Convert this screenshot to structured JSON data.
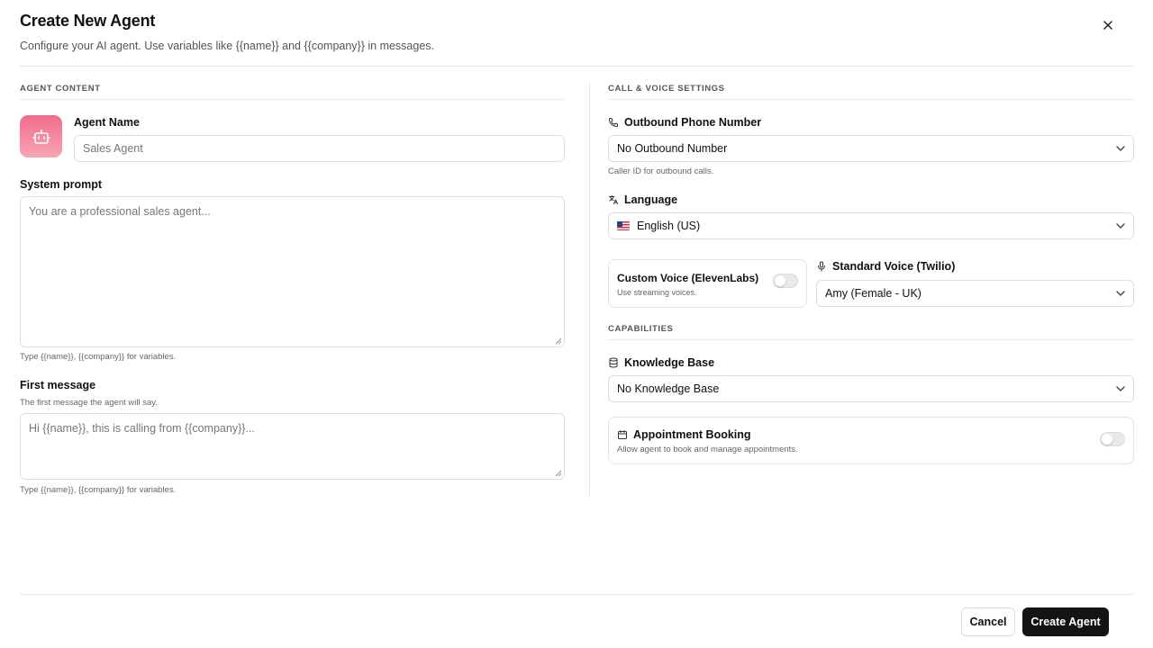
{
  "header": {
    "title": "Create New Agent",
    "subtitle": "Configure your AI agent. Use variables like {{name}} and {{company}} in messages."
  },
  "agent_content": {
    "section_title": "AGENT CONTENT",
    "agent_name": {
      "label": "Agent Name",
      "placeholder": "Sales Agent",
      "value": ""
    },
    "system_prompt": {
      "label": "System prompt",
      "placeholder": "You are a professional sales agent...",
      "hint": "Type {{name}}, {{company}} for variables."
    },
    "first_message": {
      "label": "First message",
      "description": "The first message the agent will say.",
      "placeholder": "Hi {{name}}, this is calling from {{company}}...",
      "hint": "Type {{name}}, {{company}} for variables."
    }
  },
  "call_voice": {
    "section_title": "CALL & VOICE SETTINGS",
    "outbound": {
      "label": "Outbound Phone Number",
      "value": "No Outbound Number",
      "hint": "Caller ID for outbound calls."
    },
    "language": {
      "label": "Language",
      "value": "English (US)"
    },
    "custom_voice": {
      "title": "Custom Voice (ElevenLabs)",
      "subtitle": "Use streaming voices.",
      "enabled": false
    },
    "standard_voice": {
      "label": "Standard Voice (Twilio)",
      "value": "Amy (Female - UK)"
    }
  },
  "capabilities": {
    "section_title": "CAPABILITIES",
    "knowledge_base": {
      "label": "Knowledge Base",
      "value": "No Knowledge Base"
    },
    "appointment": {
      "title": "Appointment Booking",
      "subtitle": "Allow agent to book and manage appointments.",
      "enabled": false
    }
  },
  "footer": {
    "cancel_label": "Cancel",
    "create_label": "Create Agent"
  },
  "icons": {
    "close": "close-icon",
    "avatar": "robot-icon",
    "phone": "phone-icon",
    "language": "translate-icon",
    "mic": "mic-icon",
    "database": "database-icon",
    "calendar": "calendar-icon",
    "chevron": "chevron-down-icon"
  },
  "colors": {
    "primary": "#141414",
    "avatar_top": "#f26b8c",
    "avatar_bottom": "#f7a6b4",
    "border": "#dedede"
  }
}
